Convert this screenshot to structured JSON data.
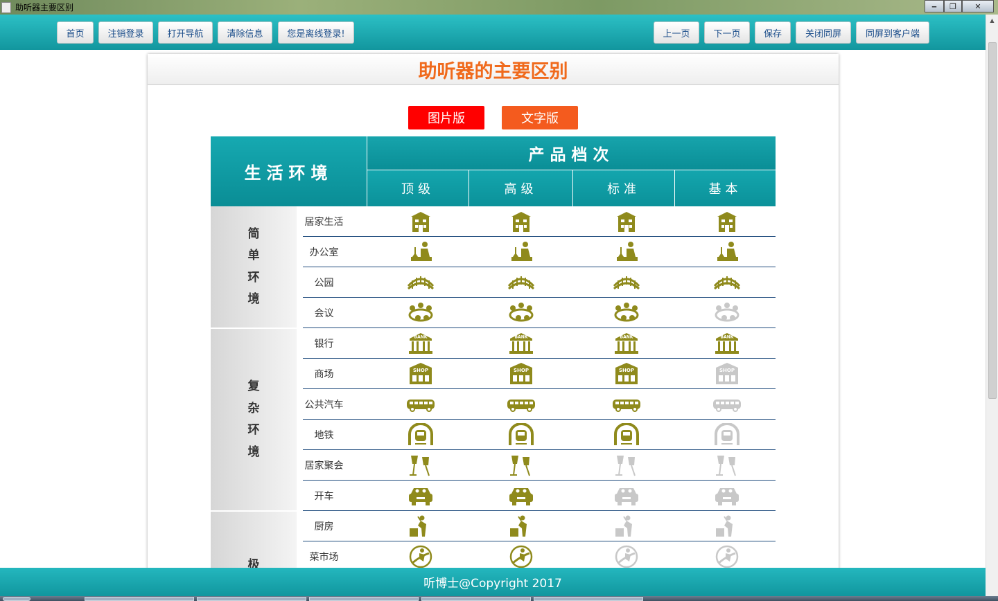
{
  "window": {
    "title": "助听器主要区别",
    "btn_min": "‒",
    "btn_max": "❐",
    "btn_close": "✕"
  },
  "toolbar": {
    "left": [
      "首页",
      "注销登录",
      "打开导航",
      "清除信息",
      "您是离线登录!"
    ],
    "right": [
      "上一页",
      "下一页",
      "保存",
      "关闭同屏",
      "同屏到客户端"
    ]
  },
  "page": {
    "title": "助听器的主要区别",
    "btn_image": "图片版",
    "btn_text": "文字版",
    "colors": {
      "accent": "#0f9ca4",
      "title": "#f06a1c",
      "btn_image": "#ff0000",
      "btn_text": "#f45b1e",
      "icon_on": "#8f8a1c",
      "icon_off": "#c8c8c8"
    }
  },
  "table": {
    "header_env": "生活环境",
    "header_level": "产品档次",
    "levels": [
      "顶级",
      "高级",
      "标准",
      "基本"
    ],
    "groups": [
      {
        "label": [
          "简",
          "单",
          "环",
          "境"
        ]
      },
      {
        "label": [
          "复",
          "杂",
          "环",
          "境"
        ]
      },
      {
        "label": [
          "极"
        ]
      }
    ],
    "rows": [
      {
        "label": "居家生活",
        "icon": "house-icon",
        "on": [
          true,
          true,
          true,
          true
        ]
      },
      {
        "label": "办公室",
        "icon": "office-worker-icon",
        "on": [
          true,
          true,
          true,
          true
        ]
      },
      {
        "label": "公园",
        "icon": "park-bridge-icon",
        "on": [
          true,
          true,
          true,
          true
        ]
      },
      {
        "label": "会议",
        "icon": "meeting-icon",
        "on": [
          true,
          true,
          true,
          false
        ]
      },
      {
        "label": "银行",
        "icon": "bank-icon",
        "on": [
          true,
          true,
          true,
          true
        ]
      },
      {
        "label": "商场",
        "icon": "shop-icon",
        "on": [
          true,
          true,
          true,
          false
        ]
      },
      {
        "label": "公共汽车",
        "icon": "bus-icon",
        "on": [
          true,
          true,
          true,
          false
        ]
      },
      {
        "label": "地铁",
        "icon": "subway-icon",
        "on": [
          true,
          true,
          true,
          false
        ]
      },
      {
        "label": "居家聚会",
        "icon": "party-glasses-icon",
        "on": [
          true,
          true,
          false,
          false
        ]
      },
      {
        "label": "开车",
        "icon": "car-icon",
        "on": [
          true,
          true,
          false,
          false
        ]
      },
      {
        "label": "厨房",
        "icon": "kitchen-icon",
        "on": [
          true,
          true,
          false,
          false
        ]
      },
      {
        "label": "菜市场",
        "icon": "market-icon",
        "on": [
          true,
          true,
          false,
          false
        ]
      }
    ],
    "bank_text": "BANK",
    "shop_text": "SHOP"
  },
  "footer": {
    "text": "听博士@Copyright 2017"
  }
}
